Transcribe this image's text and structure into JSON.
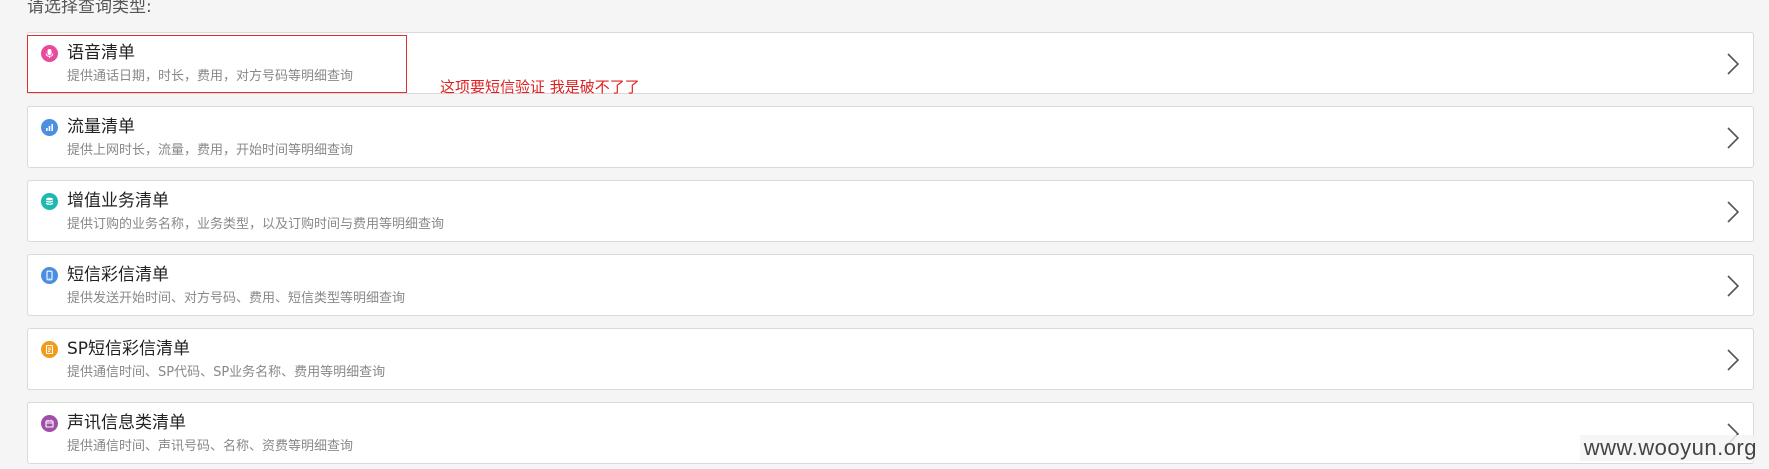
{
  "prompt": "请选择查询类型:",
  "items": [
    {
      "title": "语音清单",
      "desc": "提供通话日期，时长，费用，对方号码等明细查询",
      "icon": "microphone-icon",
      "color": "#e84a9c"
    },
    {
      "title": "流量清单",
      "desc": "提供上网时长，流量，费用，开始时间等明细查询",
      "icon": "bar-chart-icon",
      "color": "#4a8fe0"
    },
    {
      "title": "增值业务清单",
      "desc": "提供订购的业务名称，业务类型，以及订购时间与费用等明细查询",
      "icon": "stack-icon",
      "color": "#1fb8b0"
    },
    {
      "title": "短信彩信清单",
      "desc": "提供发送开始时间、对方号码、费用、短信类型等明细查询",
      "icon": "phone-icon",
      "color": "#4a8fe0"
    },
    {
      "title": "SP短信彩信清单",
      "desc": "提供通信时间、SP代码、SP业务名称、费用等明细查询",
      "icon": "document-icon",
      "color": "#f29a1a"
    },
    {
      "title": "声讯信息类清单",
      "desc": "提供通信时间、声讯号码、名称、资费等明细查询",
      "icon": "calendar-icon",
      "color": "#a04fa8"
    }
  ],
  "annotation": "这项要短信验证 我是破不了了",
  "annotation_color": "#e02020",
  "watermark": "www.wooyun.org"
}
